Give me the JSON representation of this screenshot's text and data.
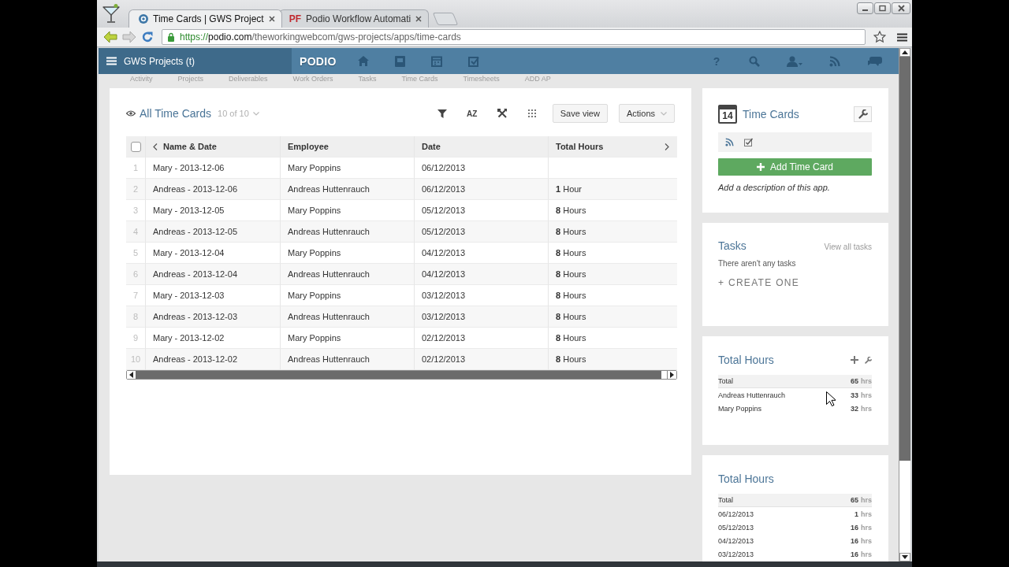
{
  "browser": {
    "tabs": [
      {
        "title": "Time Cards | GWS Project",
        "selected": true
      },
      {
        "title": "Podio Workflow Automati",
        "favicon_text": "PF",
        "selected": false
      }
    ],
    "address": {
      "scheme": "https://",
      "host": "podio.com",
      "path": "/theworkingwebcom/gws-projects/apps/time-cards"
    }
  },
  "app_header": {
    "workspace": "GWS Projects (t)",
    "logo": "PODIO",
    "help": "?"
  },
  "app_nav": [
    "Activity",
    "Projects",
    "Deliverables",
    "Work Orders",
    "Tasks",
    "Time Cards",
    "Timesheets",
    "ADD AP"
  ],
  "view": {
    "title": "All Time Cards",
    "count": "10 of 10",
    "sort": "AZ",
    "buttons": [
      {
        "label": "Save view",
        "dropdown": false
      },
      {
        "label": "Actions",
        "dropdown": true
      }
    ]
  },
  "table": {
    "all_checked": false,
    "columns": [
      "Name & Date",
      "Employee",
      "Date",
      "Total Hours"
    ],
    "rows": [
      {
        "number": "1",
        "name": "Mary - 2013-12-06",
        "employee": "Mary Poppins",
        "date": "06/12/2013"
      },
      {
        "number": "2",
        "name": "Andreas - 2013-12-06",
        "employee": "Andreas Huttenrauch",
        "date": "06/12/2013",
        "hours": "**1** Hour"
      },
      {
        "number": "3",
        "name": "Mary - 2013-12-05",
        "employee": "Mary Poppins",
        "date": "05/12/2013",
        "hours": "**8** Hours"
      },
      {
        "number": "4",
        "name": "Andreas - 2013-12-05",
        "employee": "Andreas Huttenrauch",
        "date": "05/12/2013",
        "hours": "**8** Hours"
      },
      {
        "number": "5",
        "name": "Mary - 2013-12-04",
        "employee": "Mary Poppins",
        "date": "04/12/2013",
        "hours": "**8** Hours"
      },
      {
        "number": "6",
        "name": "Andreas - 2013-12-04",
        "employee": "Andreas Huttenrauch",
        "date": "04/12/2013",
        "hours": "**8** Hours"
      },
      {
        "number": "7",
        "name": "Mary - 2013-12-03",
        "employee": "Mary Poppins",
        "date": "03/12/2013",
        "hours": "**8** Hours"
      },
      {
        "number": "8",
        "name": "Andreas - 2013-12-03",
        "employee": "Andreas Huttenrauch",
        "date": "03/12/2013",
        "hours": "**8** Hours"
      },
      {
        "number": "9",
        "name": "Mary - 2013-12-02",
        "employee": "Mary Poppins",
        "date": "02/12/2013",
        "hours": "**8** Hours"
      },
      {
        "number": "10",
        "name": "Andreas - 2013-12-02",
        "employee": "Andreas Huttenrauch",
        "date": "02/12/2013",
        "hours": "**8** Hours"
      }
    ]
  },
  "sidebar": {
    "app_card": {
      "calendar_day": "14",
      "title": "Time Cards",
      "add_button": "Add Time Card",
      "description": "Add a description of this app."
    },
    "tasks_card": {
      "title": "Tasks",
      "link": "View all tasks",
      "empty_text": "There aren't any tasks",
      "create_link": "+ CREATE ONE"
    },
    "reports": [
      {
        "title": "Total Hours",
        "has_tools": true,
        "rows": [
          {
            "label": "Total",
            "value": "65",
            "unit": "hrs",
            "kind": "total"
          },
          {
            "label": "Andreas Huttenrauch",
            "value": "33",
            "unit": "hrs",
            "kind": "item"
          },
          {
            "label": "Mary Poppins",
            "value": "32",
            "unit": "hrs",
            "kind": "item"
          }
        ]
      },
      {
        "title": "Total Hours",
        "has_tools": false,
        "rows": [
          {
            "label": "Total",
            "value": "65",
            "unit": "hrs",
            "kind": "total"
          },
          {
            "label": "06/12/2013",
            "value": "1",
            "unit": "hrs",
            "kind": "item"
          },
          {
            "label": "05/12/2013",
            "value": "16",
            "unit": "hrs",
            "kind": "item"
          },
          {
            "label": "04/12/2013",
            "value": "16",
            "unit": "hrs",
            "kind": "item"
          },
          {
            "label": "03/12/2013",
            "value": "16",
            "unit": "hrs",
            "kind": "item"
          }
        ]
      }
    ]
  }
}
